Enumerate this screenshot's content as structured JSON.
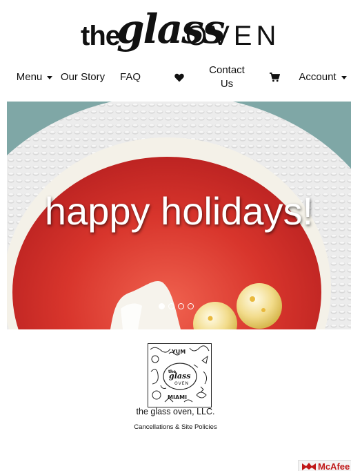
{
  "logo": {
    "the": "the",
    "glass": "glass",
    "oven": "OVEN"
  },
  "nav": {
    "menu": "Menu",
    "our_story": "Our Story",
    "faq": "FAQ",
    "favorites_icon": "heart-icon",
    "contact_line1": "Contact",
    "contact_line2": "Us",
    "cart_icon": "cart-icon",
    "account": "Account"
  },
  "hero": {
    "title": "happy holidays!",
    "slides": 4,
    "active_slide": 1
  },
  "footer": {
    "stamp_words": [
      "the",
      "glass",
      "OVEN",
      "MIAMI",
      "YUM"
    ],
    "company": "the glass oven, LLC.",
    "policies": "Cancellations & Site Policies"
  },
  "badge": {
    "text": "McAfee"
  },
  "colors": {
    "tart_red": "#d7322b",
    "plate": "#efefef",
    "cream": "#f7f4ec"
  }
}
